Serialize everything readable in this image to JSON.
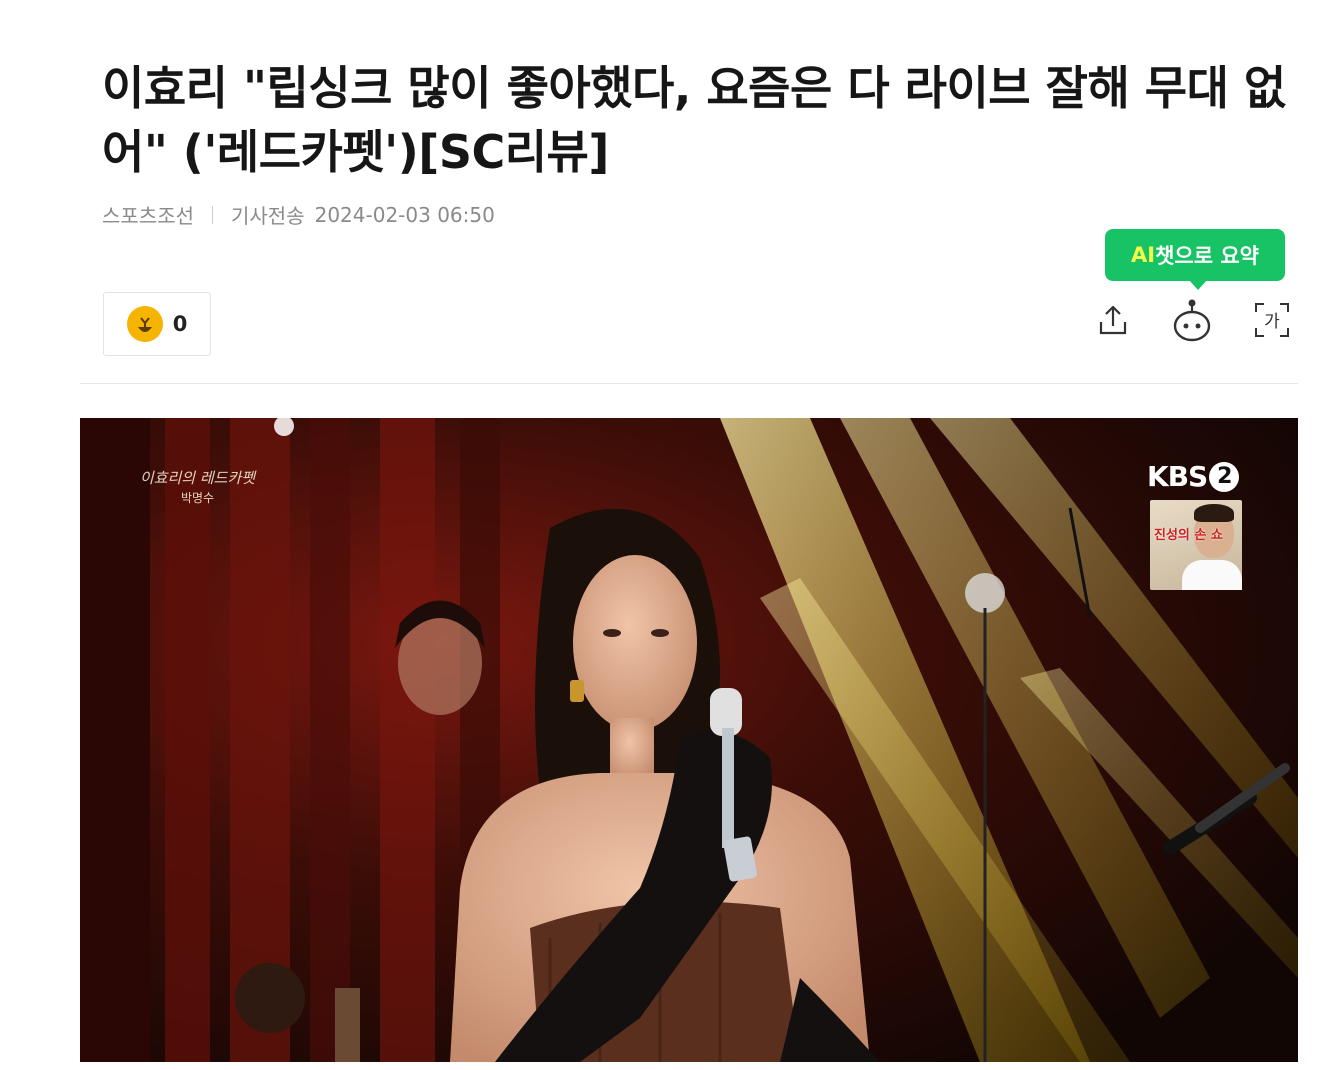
{
  "article": {
    "title": "이효리 \"립싱크 많이 좋아했다, 요즘은 다 라이브 잘해 무대 없어\" ('레드카펫')[SC리뷰]",
    "source": "스포츠조선",
    "sent_label": "기사전송",
    "datetime": "2024-02-03 06:50"
  },
  "reaction": {
    "icon": "reaction-face-icon",
    "count": "0"
  },
  "toolbar": {
    "ai_summary_prefix": "AI",
    "ai_summary_suffix": "챗으로 요약",
    "share_icon": "share-icon",
    "bot_icon": "chatbot-icon",
    "font_icon_glyph": "가",
    "accent_color": "#17c364"
  },
  "photo": {
    "show_logo": "이효리의 레드카펫",
    "show_logo_host": "박명수",
    "broadcaster": "KBS",
    "channel": "2",
    "promo_text": "진성의 손 쇼"
  }
}
